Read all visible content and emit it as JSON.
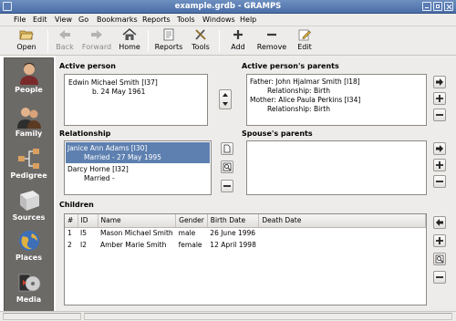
{
  "window": {
    "title": "example.grdb - GRAMPS"
  },
  "menu": [
    "File",
    "Edit",
    "View",
    "Go",
    "Bookmarks",
    "Reports",
    "Tools",
    "Windows",
    "Help"
  ],
  "toolbar": {
    "open": "Open",
    "back": "Back",
    "forward": "Forward",
    "home": "Home",
    "reports": "Reports",
    "tools": "Tools",
    "add": "Add",
    "remove": "Remove",
    "edit": "Edit"
  },
  "sidebar": {
    "people": "People",
    "family": "Family",
    "pedigree": "Pedigree",
    "sources": "Sources",
    "places": "Places",
    "media": "Media"
  },
  "active_person": {
    "label": "Active person",
    "name": "Edwin Michael Smith [I37]",
    "birth": "b. 24 May 1961"
  },
  "parents": {
    "label": "Active person's parents",
    "father": "Father: John Hjalmar Smith [I18]",
    "father_rel": "Relationship: Birth",
    "mother": "Mother: Alice Paula Perkins [I34]",
    "mother_rel": "Relationship: Birth"
  },
  "relationship": {
    "label": "Relationship",
    "items": [
      {
        "name": "Janice Ann Adams [I30]",
        "detail": "Married - 27 May 1995"
      },
      {
        "name": "Darcy Horne [I32]",
        "detail": "Married -"
      }
    ]
  },
  "spouse_parents": {
    "label": "Spouse's parents"
  },
  "children": {
    "label": "Children",
    "columns": [
      "#",
      "ID",
      "Name",
      "Gender",
      "Birth Date",
      "Death Date"
    ],
    "rows": [
      {
        "num": "1",
        "id": "I5",
        "name": "Mason Michael Smith",
        "gender": "male",
        "birth": "26 June 1996",
        "death": ""
      },
      {
        "num": "2",
        "id": "I2",
        "name": "Amber Marie Smith",
        "gender": "female",
        "birth": "12 April 1998",
        "death": ""
      }
    ]
  },
  "colors": {
    "selection": "#5e80b0",
    "titlebar": "#4b6ea8",
    "sidebar": "#6c6a67"
  }
}
